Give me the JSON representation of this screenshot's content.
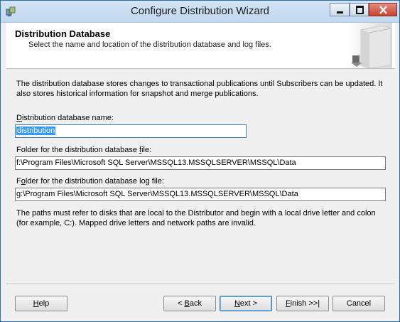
{
  "window": {
    "title": "Configure Distribution Wizard"
  },
  "header": {
    "title": "Distribution Database",
    "subtitle": "Select the name and location of the distribution database and log files."
  },
  "main": {
    "description": "The distribution database stores changes to transactional publications until Subscribers can be updated. It also stores historical information for snapshot and merge publications.",
    "db_name": {
      "label_hotkey": "D",
      "label_rest": "istribution database name:",
      "value": "distribution"
    },
    "data_folder": {
      "label_pre": "Folder for the distribution database ",
      "label_hotkey": "f",
      "label_post": "ile:",
      "value": "f:\\Program Files\\Microsoft SQL Server\\MSSQL13.MSSQLSERVER\\MSSQL\\Data"
    },
    "log_folder": {
      "label_pre": "F",
      "label_hotkey": "o",
      "label_post": "lder for the distribution database log file:",
      "value": "g:\\Program Files\\Microsoft SQL Server\\MSSQL13.MSSQLSERVER\\MSSQL\\Data"
    },
    "note": "The paths must refer to disks that are local to the Distributor and begin with a local drive letter and colon (for example, C:). Mapped drive letters and network paths are invalid."
  },
  "buttons": {
    "help": {
      "hotkey": "H",
      "rest": "elp"
    },
    "back": {
      "pre": "< ",
      "hotkey": "B",
      "rest": "ack"
    },
    "next": {
      "hotkey": "N",
      "rest": "ext >"
    },
    "finish": {
      "hotkey": "F",
      "rest": "inish >>|"
    },
    "cancel": {
      "label": "Cancel"
    }
  },
  "icons": {
    "app": "wizard-app-icon",
    "minimize": "minimize-icon",
    "maximize": "maximize-icon",
    "close": "close-icon",
    "header_art": "server-graphic"
  },
  "colors": {
    "titlebar": "#c9dcf0",
    "close_button": "#c7432f",
    "selection": "#3399ff",
    "focus_border": "#3c7fb1"
  }
}
